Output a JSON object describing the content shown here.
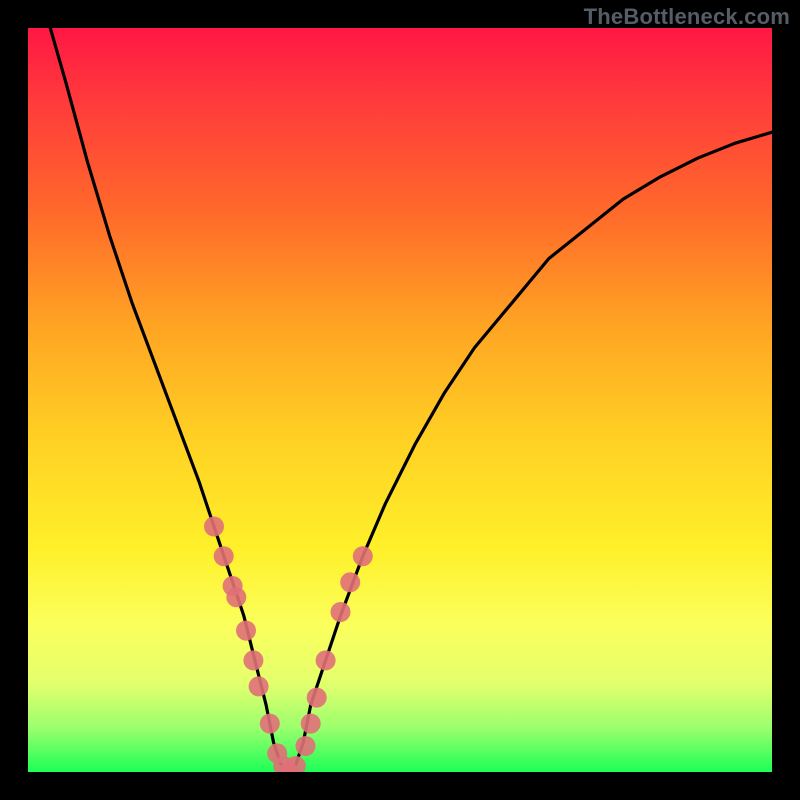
{
  "watermark": "TheBottleneck.com",
  "chart_data": {
    "type": "line",
    "title": "",
    "xlabel": "",
    "ylabel": "",
    "xlim": [
      0,
      100
    ],
    "ylim": [
      0,
      100
    ],
    "grid": false,
    "legend": false,
    "series": [
      {
        "name": "curve",
        "x": [
          3,
          5,
          8,
          11,
          14,
          17,
          20,
          23,
          25,
          27,
          29,
          30.5,
          32,
          33,
          34,
          35,
          36,
          37,
          38,
          40,
          42,
          45,
          48,
          52,
          56,
          60,
          65,
          70,
          75,
          80,
          85,
          90,
          95,
          100
        ],
        "y": [
          100,
          93,
          82,
          72,
          63,
          55,
          47,
          39,
          33,
          27,
          21,
          15,
          9,
          4,
          1,
          0,
          1,
          4,
          9,
          15,
          21,
          29,
          36,
          44,
          51,
          57,
          63,
          69,
          73,
          77,
          80,
          82.5,
          84.5,
          86
        ]
      }
    ],
    "markers": {
      "name": "dots",
      "color": "#e07078",
      "x": [
        25.0,
        26.3,
        27.5,
        28.0,
        29.3,
        30.3,
        31.0,
        32.5,
        33.5,
        34.3,
        35.0,
        36.0,
        37.3,
        38.0,
        38.8,
        40.0,
        42.0,
        43.3,
        45.0
      ],
      "y": [
        33.0,
        29.0,
        25.0,
        23.5,
        19.0,
        15.0,
        11.5,
        6.5,
        2.5,
        0.8,
        0.0,
        0.8,
        3.5,
        6.5,
        10.0,
        15.0,
        21.5,
        25.5,
        29.0
      ]
    }
  }
}
